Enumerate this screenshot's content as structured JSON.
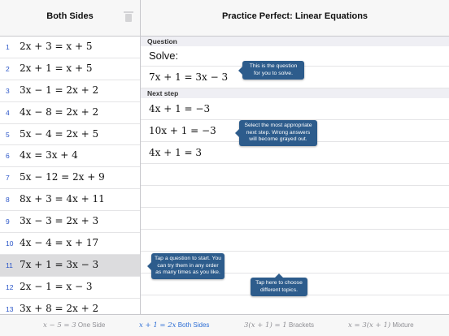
{
  "left": {
    "title": "Both Sides",
    "rows": [
      {
        "n": "1",
        "eq": "2x + 3 = x + 5"
      },
      {
        "n": "2",
        "eq": "2x + 1 = x + 5"
      },
      {
        "n": "3",
        "eq": "3x − 1 = 2x + 2"
      },
      {
        "n": "4",
        "eq": "4x − 8 = 2x + 2"
      },
      {
        "n": "5",
        "eq": "5x − 4 = 2x + 5"
      },
      {
        "n": "6",
        "eq": "4x = 3x + 4"
      },
      {
        "n": "7",
        "eq": "5x − 12 = 2x + 9"
      },
      {
        "n": "8",
        "eq": "8x + 3 = 4x + 11"
      },
      {
        "n": "9",
        "eq": "3x − 3 = 2x + 3"
      },
      {
        "n": "10",
        "eq": "4x − 4 = x + 17"
      },
      {
        "n": "11",
        "eq": "7x + 1 = 3x − 3"
      },
      {
        "n": "12",
        "eq": "2x − 1 = x − 3"
      },
      {
        "n": "13",
        "eq": "3x + 8 = 2x + 2"
      }
    ]
  },
  "right": {
    "title": "Practice Perfect: Linear Equations",
    "question_header": "Question",
    "solve_label": "Solve:",
    "question_eq": "7x + 1 = 3x − 3",
    "next_header": "Next step",
    "options": [
      "4x + 1 = −3",
      "10x + 1 = −3",
      "4x + 1 = 3"
    ]
  },
  "callouts": {
    "question": "This is the question for you to solve.",
    "next": "Select the most appropriate next step. Wrong answers will become grayed out.",
    "start": "Tap a question to start. You can try them in any order as many times as you like.",
    "topics": "Tap here to choose different topics."
  },
  "tabs": [
    {
      "math": "x − 5 = 3",
      "label": "One Side"
    },
    {
      "math": "x + 1 = 2x",
      "label": "Both Sides"
    },
    {
      "math": "3(x + 1) = 1",
      "label": "Brackets"
    },
    {
      "math": "x = 3(x + 1)",
      "label": "Mixture"
    }
  ],
  "colors": {
    "accent": "#2e6fd6",
    "callout": "#2d5c8c",
    "selected": "#dcdcde"
  }
}
